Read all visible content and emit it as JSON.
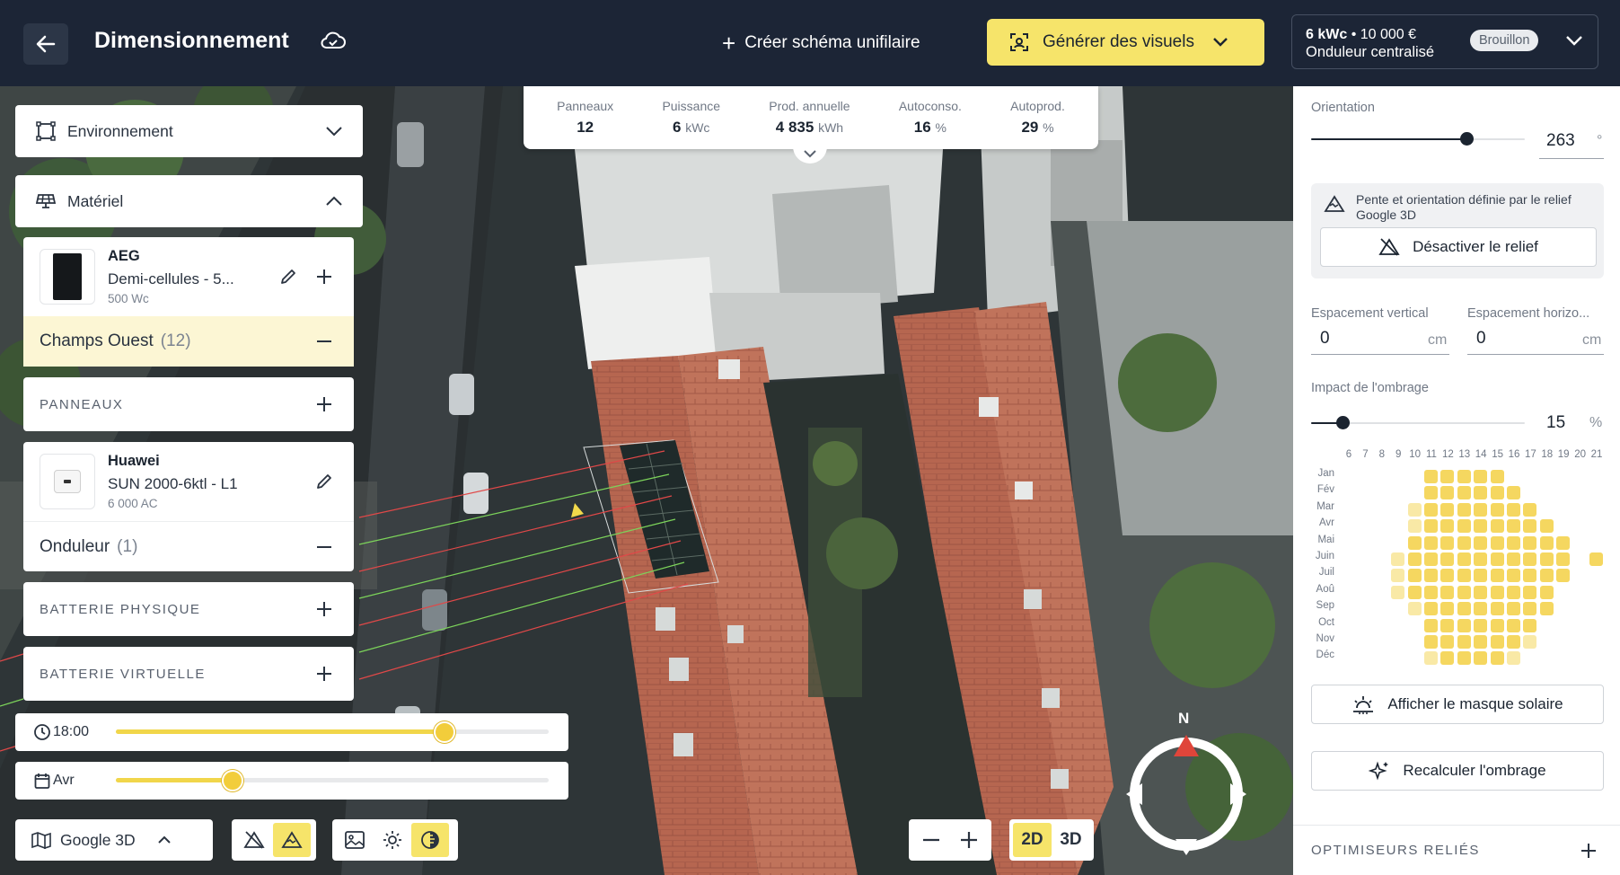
{
  "header": {
    "title": "Dimensionnement",
    "schema_button": "Créer schéma unifilaire",
    "generate_button": "Générer des visuels",
    "project_power": "6 kWc",
    "project_price": "10 000 €",
    "project_sep": "•",
    "project_inverter": "Onduleur centralisé",
    "status_badge": "Brouillon"
  },
  "stats": [
    {
      "label": "Panneaux",
      "value": "12",
      "unit": ""
    },
    {
      "label": "Puissance",
      "value": "6",
      "unit": "kWc"
    },
    {
      "label": "Prod. annuelle",
      "value": "4 835",
      "unit": "kWh"
    },
    {
      "label": "Autoconso.",
      "value": "16",
      "unit": "%"
    },
    {
      "label": "Autoprod.",
      "value": "29",
      "unit": "%"
    }
  ],
  "left_panel": {
    "environment_label": "Environnement",
    "material_label": "Matériel",
    "panel_item": {
      "brand": "AEG",
      "model": "Demi-cellules - 5...",
      "power": "500 Wc"
    },
    "field_group": {
      "name": "Champs Ouest",
      "count": "(12)"
    },
    "panels_section": "PANNEAUX",
    "inverter_item": {
      "brand": "Huawei",
      "model": "SUN 2000-6ktl - L1",
      "power": "6 000 AC"
    },
    "inverter_group": {
      "name": "Onduleur",
      "count": "(1)"
    },
    "battery_physical": "BATTERIE PHYSIQUE",
    "battery_virtual": "BATTERIE VIRTUELLE"
  },
  "map_controls": {
    "time_value": "18:00",
    "time_fraction": 0.76,
    "month_value": "Avr",
    "month_fraction": 0.27,
    "view_mode": "Google 3D",
    "btn_2d": "2D",
    "btn_3d": "3D",
    "compass_north": "N"
  },
  "right_panel": {
    "orientation_label": "Orientation",
    "orientation_value": "263",
    "orientation_unit": "°",
    "orientation_fraction": 0.73,
    "relief_note": "Pente et orientation définie par le relief Google 3D",
    "relief_button": "Désactiver le relief",
    "spacing_vertical_label": "Espacement vertical",
    "spacing_vertical_value": "0",
    "spacing_horizontal_label": "Espacement horizo...",
    "spacing_horizontal_value": "0",
    "spacing_unit": "cm",
    "shading_label": "Impact de l'ombrage",
    "shading_value": "15",
    "shading_unit": "%",
    "shading_fraction": 0.15,
    "solar_mask_button": "Afficher le masque solaire",
    "recalc_button": "Recalculer l'ombrage",
    "optimizers_label": "OPTIMISEURS RELIÉS"
  },
  "heatmap": {
    "hours": [
      "6",
      "7",
      "8",
      "9",
      "10",
      "11",
      "12",
      "13",
      "14",
      "15",
      "16",
      "17",
      "18",
      "19",
      "20",
      "21"
    ],
    "months": [
      "Jan",
      "Fév",
      "Mar",
      "Avr",
      "Mai",
      "Juin",
      "Juil",
      "Aoû",
      "Sep",
      "Oct",
      "Nov",
      "Déc"
    ],
    "cell_color": "#f5d760",
    "cell_color_light": "#f9e9a6",
    "rows": [
      [
        0,
        0,
        0,
        0,
        0,
        1,
        1,
        1,
        1,
        1,
        0,
        0,
        0,
        0,
        0,
        0
      ],
      [
        0,
        0,
        0,
        0,
        0,
        1,
        1,
        1,
        1,
        1,
        1,
        0,
        0,
        0,
        0,
        0
      ],
      [
        0,
        0,
        0,
        0,
        2,
        1,
        1,
        1,
        1,
        1,
        1,
        1,
        0,
        0,
        0,
        0
      ],
      [
        0,
        0,
        0,
        0,
        2,
        1,
        1,
        1,
        1,
        1,
        1,
        1,
        1,
        0,
        0,
        0
      ],
      [
        0,
        0,
        0,
        0,
        1,
        1,
        1,
        1,
        1,
        1,
        1,
        1,
        1,
        1,
        0,
        0
      ],
      [
        0,
        0,
        0,
        2,
        1,
        1,
        1,
        1,
        1,
        1,
        1,
        1,
        1,
        1,
        0,
        1
      ],
      [
        0,
        0,
        0,
        2,
        1,
        1,
        1,
        1,
        1,
        1,
        1,
        1,
        1,
        1,
        0,
        0
      ],
      [
        0,
        0,
        0,
        2,
        1,
        1,
        1,
        1,
        1,
        1,
        1,
        1,
        1,
        0,
        0,
        0
      ],
      [
        0,
        0,
        0,
        0,
        2,
        1,
        1,
        1,
        1,
        1,
        1,
        1,
        1,
        0,
        0,
        0
      ],
      [
        0,
        0,
        0,
        0,
        0,
        1,
        1,
        1,
        1,
        1,
        1,
        1,
        0,
        0,
        0,
        0
      ],
      [
        0,
        0,
        0,
        0,
        0,
        1,
        1,
        1,
        1,
        1,
        1,
        2,
        0,
        0,
        0,
        0
      ],
      [
        0,
        0,
        0,
        0,
        0,
        2,
        1,
        1,
        1,
        1,
        2,
        0,
        0,
        0,
        0,
        0
      ]
    ]
  },
  "colors": {
    "accent_yellow": "#f6e46a",
    "header_bg": "#1c2536",
    "roof_terracotta": "#b86a52"
  }
}
